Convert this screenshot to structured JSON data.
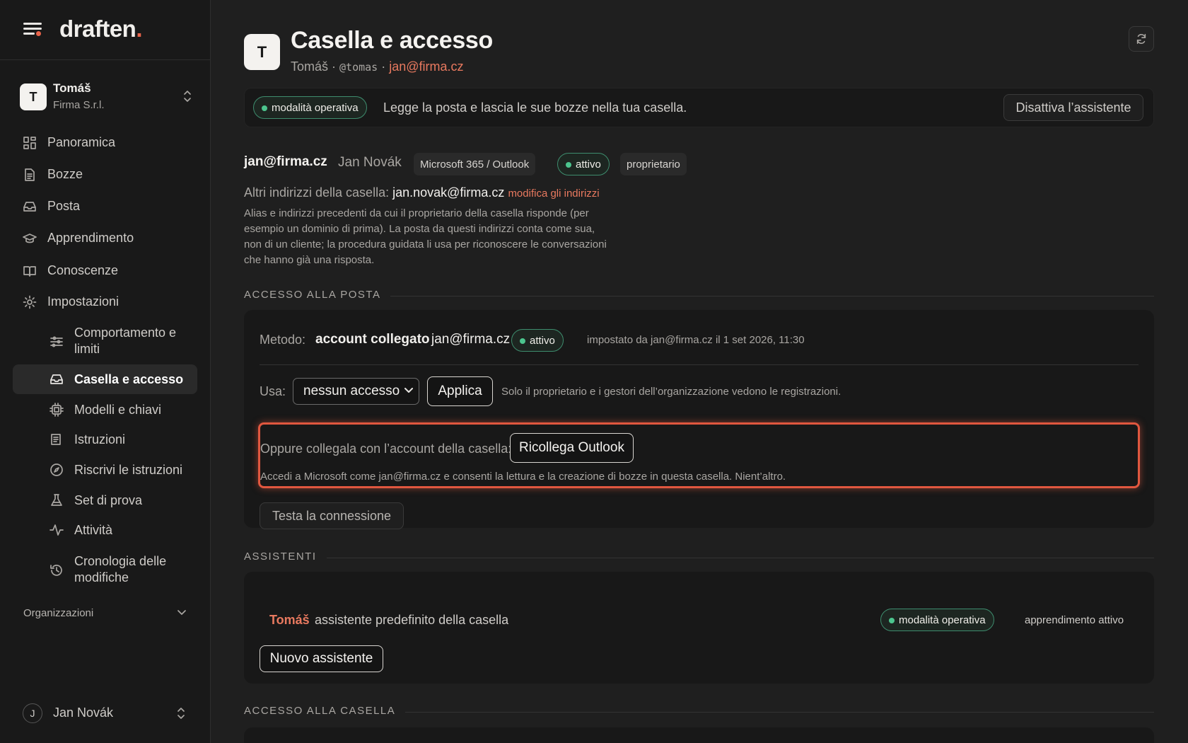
{
  "brand": {
    "name": "draften",
    "dot": "."
  },
  "workspace": {
    "initial": "T",
    "name": "Tomáš",
    "org": "Firma S.r.l."
  },
  "nav": [
    {
      "label": "Panoramica",
      "icon": "grid-icon"
    },
    {
      "label": "Bozze",
      "icon": "document-icon"
    },
    {
      "label": "Posta",
      "icon": "inbox-icon"
    },
    {
      "label": "Apprendimento",
      "icon": "graduation-cap-icon"
    },
    {
      "label": "Conoscenze",
      "icon": "book-icon"
    },
    {
      "label": "Impostazioni",
      "icon": "gear-icon"
    }
  ],
  "subnav": [
    {
      "label": "Comportamento e",
      "label2": "limiti",
      "icon": "sliders-icon"
    },
    {
      "label": "Casella e accesso",
      "icon": "inbox-icon",
      "active": true
    },
    {
      "label": "Modelli e chiavi",
      "icon": "chip-icon"
    },
    {
      "label": "Istruzioni",
      "icon": "list-icon"
    },
    {
      "label": "Riscrivi le istruzioni",
      "icon": "compass-icon"
    },
    {
      "label": "Set di prova",
      "icon": "flask-icon"
    },
    {
      "label": "Attività",
      "icon": "pulse-icon"
    },
    {
      "label": "Cronologia delle",
      "label2": "modifiche",
      "icon": "history-icon"
    }
  ],
  "organizations_label": "Organizzazioni",
  "user": {
    "initial": "J",
    "name": "Jan Novák"
  },
  "page": {
    "initial": "T",
    "title": "Casella e accesso",
    "sub_name": "Tomáš ·",
    "sub_handle": "@tomas",
    "sub_sep": "·",
    "sub_email": "jan@firma.cz"
  },
  "banner": {
    "status": "modalità operativa",
    "text": "Legge la posta e lascia le sue bozze nella tua casella.",
    "button": "Disattiva l’assistente"
  },
  "mailbox": {
    "email": "jan@firma.cz",
    "name": "Jan Novák",
    "provider": "Microsoft 365 / Outlook",
    "status": "attivo",
    "role": "proprietario",
    "alt_label": "Altri indirizzi della casella:",
    "alt_value": "jan.novak@firma.cz",
    "alt_link": "modifica gli indirizzi",
    "alt_desc": "Alias e indirizzi precedenti da cui il proprietario della casella risponde (per esempio un dominio di prima). La posta da questi indirizzi conta come sua, non di un cliente; la procedura guidata li usa per riconoscere le conversazioni che hanno già una risposta."
  },
  "mail_access": {
    "heading": "ACCESSO ALLA POSTA",
    "method_label": "Metodo:",
    "method_value": "account collegato",
    "method_email": "jan@firma.cz",
    "method_status": "attivo",
    "method_meta": "impostato da jan@firma.cz il 1 set 2026, 11:30",
    "use_label": "Usa:",
    "use_value": "nessun accesso",
    "apply_button": "Applica",
    "use_note": "Solo il proprietario e i gestori dell’organizzazione vedono le registrazioni.",
    "relink_label": "Oppure collegala con l’account della casella:",
    "relink_button": "Ricollega Outlook",
    "relink_note": "Accedi a Microsoft come jan@firma.cz e consenti la lettura e la creazione di bozze in questa casella. Nient’altro.",
    "test_button": "Testa la connessione"
  },
  "assistants": {
    "heading": "ASSISTENTI",
    "name": "Tomáš",
    "desc": "assistente predefinito della casella",
    "status": "modalità operativa",
    "learning": "apprendimento attivo",
    "new_button": "Nuovo assistente"
  },
  "mailbox_access": {
    "heading": "ACCESSO ALLA CASELLA"
  },
  "colors": {
    "accent": "#e8634a",
    "link": "#e8795f",
    "success": "#4cc58e",
    "highlight": "#e0573f"
  }
}
